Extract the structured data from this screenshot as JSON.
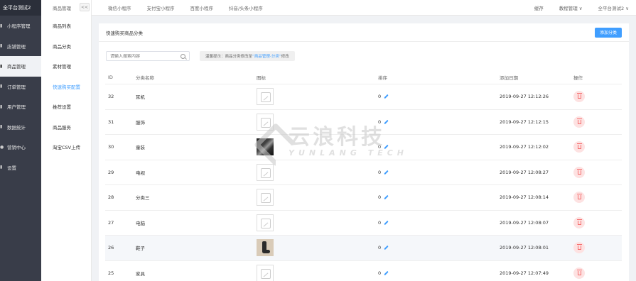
{
  "sidebar": {
    "brand": "全平台测试2",
    "items": [
      {
        "icon": "▮",
        "label": "小程序管理"
      },
      {
        "icon": "▮",
        "label": "店铺管理"
      },
      {
        "icon": "▮",
        "label": "商品管理"
      },
      {
        "icon": "▮",
        "label": "订单管理"
      },
      {
        "icon": "▮",
        "label": "用户管理"
      },
      {
        "icon": "▮",
        "label": "数据统计"
      },
      {
        "icon": "●",
        "label": "营销中心"
      },
      {
        "icon": "▮",
        "label": "设置"
      }
    ]
  },
  "subnav": {
    "title": "商品管理",
    "collapse": "<<",
    "items": [
      {
        "label": "商品列表"
      },
      {
        "label": "商品分类"
      },
      {
        "label": "素材管理"
      },
      {
        "label": "快速购买配置"
      },
      {
        "label": "推荐设置"
      },
      {
        "label": "商品服务"
      },
      {
        "label": "淘宝CSV上传"
      }
    ]
  },
  "topbar": {
    "tabs": [
      "微信小程序",
      "支付宝小程序",
      "百度小程序",
      "抖音/头条小程序"
    ],
    "right": [
      "缓存",
      "教程管理 ∨",
      "全平台测试2 ∨"
    ]
  },
  "card": {
    "title": "快速购买商品分类",
    "add_button": "添加分类"
  },
  "search": {
    "placeholder": "请输入搜索内容"
  },
  "tip": {
    "prefix": "温馨提示：商品分类修改至 ",
    "link": "“商品管理-分类”",
    "suffix": " 修改"
  },
  "table": {
    "headers": {
      "id": "ID",
      "name": "分类名称",
      "icon": "图标",
      "sort": "排序",
      "date": "添加日期",
      "op": "操作"
    },
    "rows": [
      {
        "id": "32",
        "name": "耳机",
        "icon": "placeholder",
        "sort": "0",
        "date": "2019-09-27 12:12:26"
      },
      {
        "id": "31",
        "name": "服饰",
        "icon": "placeholder",
        "sort": "0",
        "date": "2019-09-27 12:12:15"
      },
      {
        "id": "30",
        "name": "童装",
        "icon": "photo-dark",
        "sort": "0",
        "date": "2019-09-27 12:12:02"
      },
      {
        "id": "29",
        "name": "电视",
        "icon": "placeholder",
        "sort": "0",
        "date": "2019-09-27 12:08:27"
      },
      {
        "id": "28",
        "name": "分类三",
        "icon": "placeholder",
        "sort": "0",
        "date": "2019-09-27 12:08:14"
      },
      {
        "id": "27",
        "name": "电脑",
        "icon": "placeholder",
        "sort": "0",
        "date": "2019-09-27 12:08:07"
      },
      {
        "id": "26",
        "name": "鞋子",
        "icon": "photo-shoe",
        "sort": "0",
        "date": "2019-09-27 12:08:01"
      },
      {
        "id": "25",
        "name": "家具",
        "icon": "placeholder",
        "sort": "0",
        "date": "2019-09-27 12:07:49"
      }
    ]
  },
  "watermark": {
    "cn": "云浪科技",
    "en": "YUNLANG TECH"
  },
  "colors": {
    "sidebar": "#393d49",
    "primary": "#409eff",
    "danger": "#f56c6c"
  }
}
